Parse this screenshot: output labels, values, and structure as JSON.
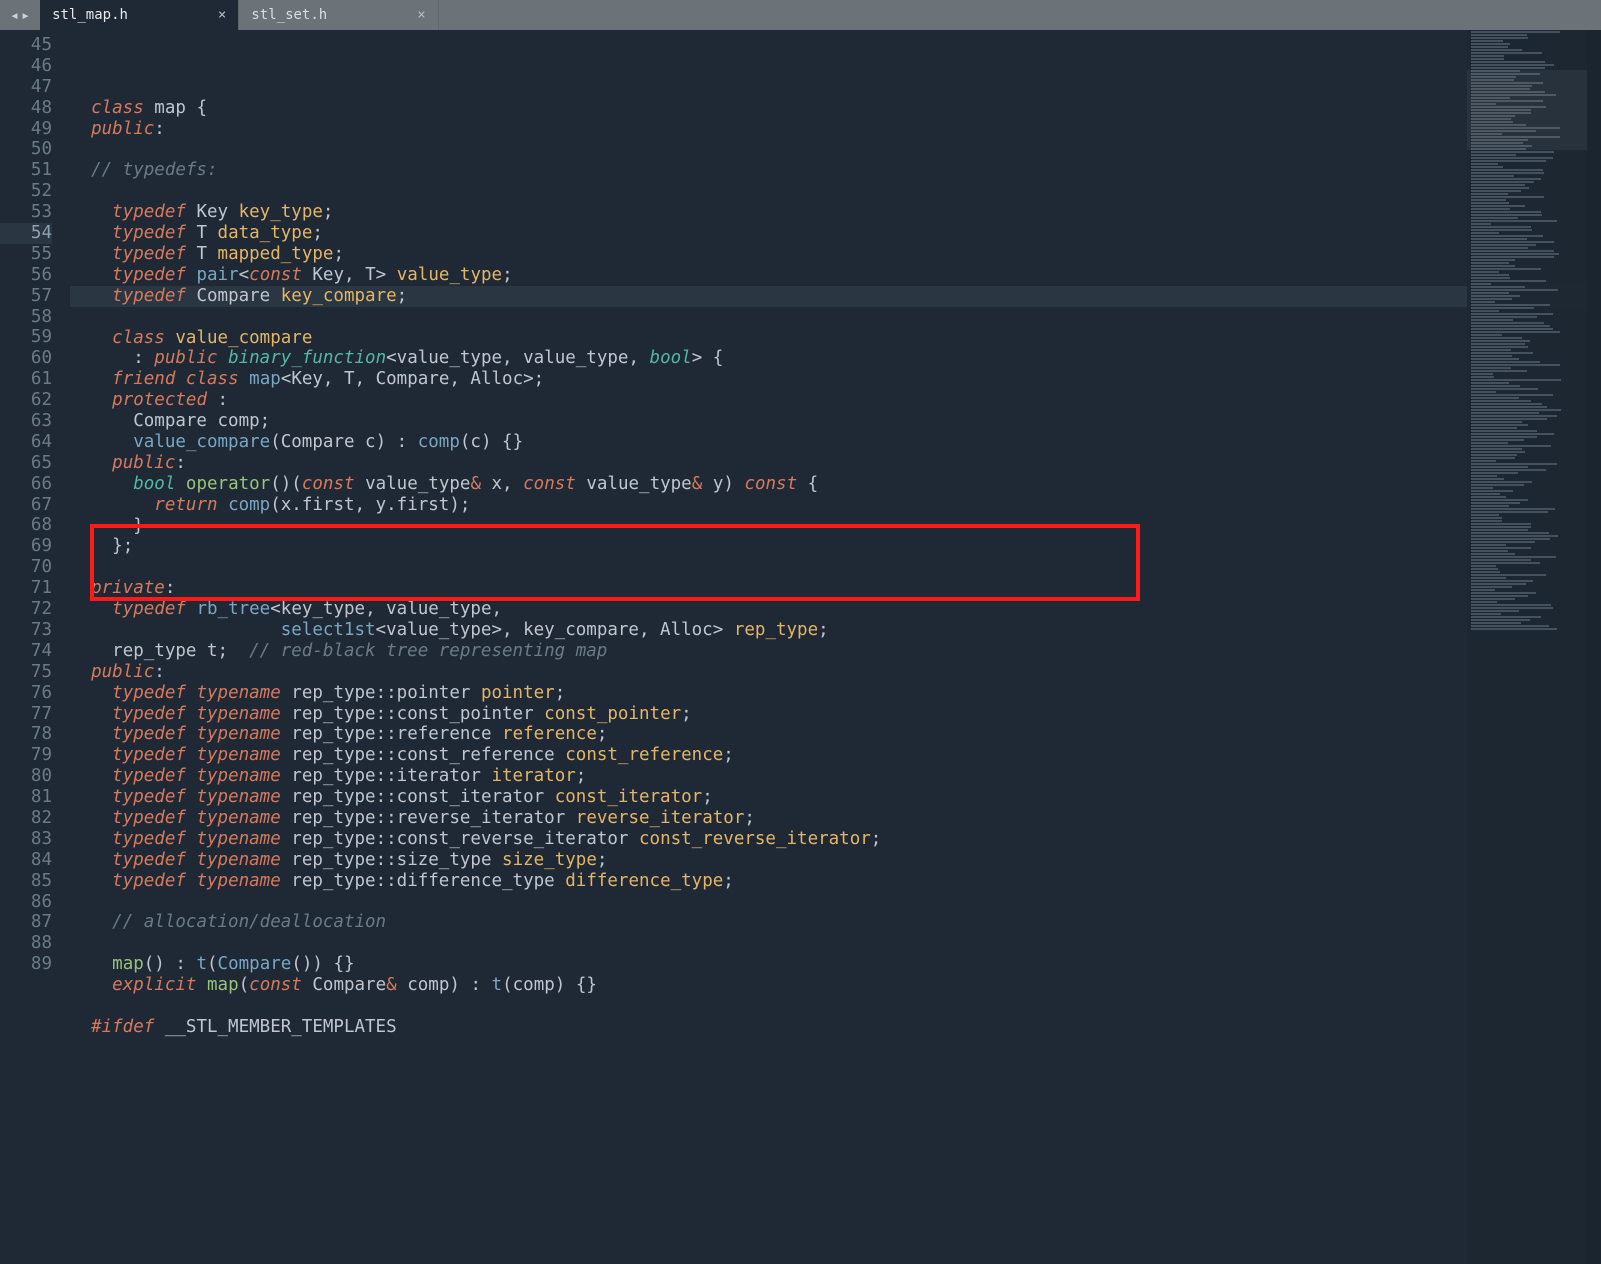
{
  "tabs": [
    {
      "label": "stl_map.h",
      "active": true
    },
    {
      "label": "stl_set.h",
      "active": false
    }
  ],
  "first_line_no": 45,
  "cursor_line_no": 54,
  "highlight_box": {
    "first_line_no": 68,
    "last_line_no": 71
  },
  "code_lines": [
    {
      "n": 45,
      "tokens": [
        [
          "  ",
          ""
        ],
        [
          "class",
          "kw"
        ],
        [
          " map ",
          " "
        ],
        [
          "{",
          "punc"
        ]
      ]
    },
    {
      "n": 46,
      "tokens": [
        [
          "  ",
          ""
        ],
        [
          "public",
          "kw"
        ],
        [
          ":",
          "punc"
        ]
      ]
    },
    {
      "n": 47,
      "tokens": [
        [
          "",
          ""
        ]
      ]
    },
    {
      "n": 48,
      "tokens": [
        [
          "  ",
          ""
        ],
        [
          "// typedefs:",
          "comment"
        ]
      ]
    },
    {
      "n": 49,
      "tokens": [
        [
          "",
          ""
        ]
      ]
    },
    {
      "n": 50,
      "tokens": [
        [
          "    ",
          ""
        ],
        [
          "typedef",
          "kw"
        ],
        [
          " Key ",
          " "
        ],
        [
          "key_type",
          "mem"
        ],
        [
          ";",
          "punc"
        ]
      ]
    },
    {
      "n": 51,
      "tokens": [
        [
          "    ",
          ""
        ],
        [
          "typedef",
          "kw"
        ],
        [
          " T ",
          " "
        ],
        [
          "data_type",
          "mem"
        ],
        [
          ";",
          "punc"
        ]
      ]
    },
    {
      "n": 52,
      "tokens": [
        [
          "    ",
          ""
        ],
        [
          "typedef",
          "kw"
        ],
        [
          " T ",
          " "
        ],
        [
          "mapped_type",
          "mem"
        ],
        [
          ";",
          "punc"
        ]
      ]
    },
    {
      "n": 53,
      "tokens": [
        [
          "    ",
          ""
        ],
        [
          "typedef",
          "kw"
        ],
        [
          " ",
          " "
        ],
        [
          "pair",
          "func"
        ],
        [
          "<",
          "punc"
        ],
        [
          "const",
          "kw"
        ],
        [
          " Key, T",
          " "
        ],
        [
          ">",
          "punc"
        ],
        [
          " ",
          " "
        ],
        [
          "value_type",
          "mem"
        ],
        [
          ";",
          "punc"
        ]
      ]
    },
    {
      "n": 54,
      "tokens": [
        [
          "    ",
          ""
        ],
        [
          "typedef",
          "kw"
        ],
        [
          " Compare ",
          " "
        ],
        [
          "key_compare",
          "mem"
        ],
        [
          ";",
          "punc"
        ]
      ]
    },
    {
      "n": 55,
      "tokens": [
        [
          "",
          ""
        ]
      ]
    },
    {
      "n": 56,
      "tokens": [
        [
          "    ",
          ""
        ],
        [
          "class",
          "kw"
        ],
        [
          " ",
          " "
        ],
        [
          "value_compare",
          "mem"
        ]
      ]
    },
    {
      "n": 57,
      "tokens": [
        [
          "      ",
          ""
        ],
        [
          ": ",
          "punc"
        ],
        [
          "public",
          "kw"
        ],
        [
          " ",
          " "
        ],
        [
          "binary_function",
          "teal"
        ],
        [
          "<",
          "punc"
        ],
        [
          "value_type, value_type, ",
          " "
        ],
        [
          "bool",
          "teal"
        ],
        [
          ">",
          "punc"
        ],
        [
          " {",
          "punc"
        ]
      ]
    },
    {
      "n": 58,
      "tokens": [
        [
          "    ",
          ""
        ],
        [
          "friend",
          "kw"
        ],
        [
          " ",
          " "
        ],
        [
          "class",
          "kw"
        ],
        [
          " ",
          " "
        ],
        [
          "map",
          "func"
        ],
        [
          "<",
          "punc"
        ],
        [
          "Key, T, Compare, Alloc",
          " "
        ],
        [
          ">",
          "punc"
        ],
        [
          ";",
          "punc"
        ]
      ]
    },
    {
      "n": 59,
      "tokens": [
        [
          "    ",
          ""
        ],
        [
          "protected",
          "kw"
        ],
        [
          " :",
          "punc"
        ]
      ]
    },
    {
      "n": 60,
      "tokens": [
        [
          "      ",
          ""
        ],
        [
          "Compare comp;",
          "type"
        ]
      ]
    },
    {
      "n": 61,
      "tokens": [
        [
          "      ",
          ""
        ],
        [
          "value_compare",
          "func"
        ],
        [
          "(",
          "punc"
        ],
        [
          "Compare c",
          " "
        ],
        [
          ")",
          "punc"
        ],
        [
          " : ",
          "punc"
        ],
        [
          "comp",
          "func"
        ],
        [
          "(",
          "punc"
        ],
        [
          "c",
          " "
        ],
        [
          ")",
          "punc"
        ],
        [
          " {}",
          "punc"
        ]
      ]
    },
    {
      "n": 62,
      "tokens": [
        [
          "    ",
          ""
        ],
        [
          "public",
          "kw"
        ],
        [
          ":",
          "punc"
        ]
      ]
    },
    {
      "n": 63,
      "tokens": [
        [
          "      ",
          ""
        ],
        [
          "bool",
          "teal"
        ],
        [
          " ",
          " "
        ],
        [
          "operator",
          "green"
        ],
        [
          "()",
          "punc"
        ],
        [
          "(",
          "punc"
        ],
        [
          "const",
          "kw"
        ],
        [
          " value_type",
          " "
        ],
        [
          "&",
          "amp"
        ],
        [
          " x, ",
          " "
        ],
        [
          "const",
          "kw"
        ],
        [
          " value_type",
          " "
        ],
        [
          "&",
          "amp"
        ],
        [
          " y",
          " "
        ],
        [
          ")",
          "punc"
        ],
        [
          " ",
          " "
        ],
        [
          "const",
          "kw"
        ],
        [
          " {",
          "punc"
        ]
      ]
    },
    {
      "n": 64,
      "tokens": [
        [
          "        ",
          ""
        ],
        [
          "return",
          "kw"
        ],
        [
          " ",
          " "
        ],
        [
          "comp",
          "func"
        ],
        [
          "(",
          "punc"
        ],
        [
          "x.first, y.first",
          " "
        ],
        [
          ")",
          "punc"
        ],
        [
          ";",
          "punc"
        ]
      ]
    },
    {
      "n": 65,
      "tokens": [
        [
          "      ",
          ""
        ],
        [
          "}",
          "punc"
        ]
      ]
    },
    {
      "n": 66,
      "tokens": [
        [
          "    ",
          ""
        ],
        [
          "};",
          "punc"
        ]
      ]
    },
    {
      "n": 67,
      "tokens": [
        [
          "",
          ""
        ]
      ]
    },
    {
      "n": 68,
      "tokens": [
        [
          "  ",
          ""
        ],
        [
          "private",
          "kw"
        ],
        [
          ":",
          "punc"
        ]
      ]
    },
    {
      "n": 69,
      "tokens": [
        [
          "    ",
          ""
        ],
        [
          "typedef",
          "kw"
        ],
        [
          " ",
          " "
        ],
        [
          "rb_tree",
          "func"
        ],
        [
          "<",
          "punc"
        ],
        [
          "key_type, value_type, ",
          " "
        ]
      ]
    },
    {
      "n": 70,
      "tokens": [
        [
          "                    ",
          ""
        ],
        [
          "select1st",
          "func"
        ],
        [
          "<",
          "punc"
        ],
        [
          "value_type",
          " "
        ],
        [
          ">",
          "punc"
        ],
        [
          ", key_compare, Alloc",
          " "
        ],
        [
          ">",
          "punc"
        ],
        [
          " ",
          " "
        ],
        [
          "rep_type",
          "mem"
        ],
        [
          ";",
          "punc"
        ]
      ]
    },
    {
      "n": 71,
      "tokens": [
        [
          "    ",
          ""
        ],
        [
          "rep_type t;  ",
          " "
        ],
        [
          "// red-black tree representing map",
          "comment"
        ]
      ]
    },
    {
      "n": 72,
      "tokens": [
        [
          "  ",
          ""
        ],
        [
          "public",
          "kw"
        ],
        [
          ":",
          "punc"
        ]
      ]
    },
    {
      "n": 73,
      "tokens": [
        [
          "    ",
          ""
        ],
        [
          "typedef",
          "kw"
        ],
        [
          " ",
          " "
        ],
        [
          "typename",
          "kw"
        ],
        [
          " rep_type::pointer ",
          " "
        ],
        [
          "pointer",
          "mem"
        ],
        [
          ";",
          "punc"
        ]
      ]
    },
    {
      "n": 74,
      "tokens": [
        [
          "    ",
          ""
        ],
        [
          "typedef",
          "kw"
        ],
        [
          " ",
          " "
        ],
        [
          "typename",
          "kw"
        ],
        [
          " rep_type::const_pointer ",
          " "
        ],
        [
          "const_pointer",
          "mem"
        ],
        [
          ";",
          "punc"
        ]
      ]
    },
    {
      "n": 75,
      "tokens": [
        [
          "    ",
          ""
        ],
        [
          "typedef",
          "kw"
        ],
        [
          " ",
          " "
        ],
        [
          "typename",
          "kw"
        ],
        [
          " rep_type::reference ",
          " "
        ],
        [
          "reference",
          "mem"
        ],
        [
          ";",
          "punc"
        ]
      ]
    },
    {
      "n": 76,
      "tokens": [
        [
          "    ",
          ""
        ],
        [
          "typedef",
          "kw"
        ],
        [
          " ",
          " "
        ],
        [
          "typename",
          "kw"
        ],
        [
          " rep_type::const_reference ",
          " "
        ],
        [
          "const_reference",
          "mem"
        ],
        [
          ";",
          "punc"
        ]
      ]
    },
    {
      "n": 77,
      "tokens": [
        [
          "    ",
          ""
        ],
        [
          "typedef",
          "kw"
        ],
        [
          " ",
          " "
        ],
        [
          "typename",
          "kw"
        ],
        [
          " rep_type::iterator ",
          " "
        ],
        [
          "iterator",
          "mem"
        ],
        [
          ";",
          "punc"
        ]
      ]
    },
    {
      "n": 78,
      "tokens": [
        [
          "    ",
          ""
        ],
        [
          "typedef",
          "kw"
        ],
        [
          " ",
          " "
        ],
        [
          "typename",
          "kw"
        ],
        [
          " rep_type::const_iterator ",
          " "
        ],
        [
          "const_iterator",
          "mem"
        ],
        [
          ";",
          "punc"
        ]
      ]
    },
    {
      "n": 79,
      "tokens": [
        [
          "    ",
          ""
        ],
        [
          "typedef",
          "kw"
        ],
        [
          " ",
          " "
        ],
        [
          "typename",
          "kw"
        ],
        [
          " rep_type::reverse_iterator ",
          " "
        ],
        [
          "reverse_iterator",
          "mem"
        ],
        [
          ";",
          "punc"
        ]
      ]
    },
    {
      "n": 80,
      "tokens": [
        [
          "    ",
          ""
        ],
        [
          "typedef",
          "kw"
        ],
        [
          " ",
          " "
        ],
        [
          "typename",
          "kw"
        ],
        [
          " rep_type::const_reverse_iterator ",
          " "
        ],
        [
          "const_reverse_iterator",
          "mem"
        ],
        [
          ";",
          "punc"
        ]
      ]
    },
    {
      "n": 81,
      "tokens": [
        [
          "    ",
          ""
        ],
        [
          "typedef",
          "kw"
        ],
        [
          " ",
          " "
        ],
        [
          "typename",
          "kw"
        ],
        [
          " rep_type::size_type ",
          " "
        ],
        [
          "size_type",
          "mem"
        ],
        [
          ";",
          "punc"
        ]
      ]
    },
    {
      "n": 82,
      "tokens": [
        [
          "    ",
          ""
        ],
        [
          "typedef",
          "kw"
        ],
        [
          " ",
          " "
        ],
        [
          "typename",
          "kw"
        ],
        [
          " rep_type::difference_type ",
          " "
        ],
        [
          "difference_type",
          "mem"
        ],
        [
          ";",
          "punc"
        ]
      ]
    },
    {
      "n": 83,
      "tokens": [
        [
          "",
          ""
        ]
      ]
    },
    {
      "n": 84,
      "tokens": [
        [
          "    ",
          ""
        ],
        [
          "// allocation/deallocation",
          "comment"
        ]
      ]
    },
    {
      "n": 85,
      "tokens": [
        [
          "",
          ""
        ]
      ]
    },
    {
      "n": 86,
      "tokens": [
        [
          "    ",
          ""
        ],
        [
          "map",
          "green"
        ],
        [
          "()",
          "punc"
        ],
        [
          " : ",
          "punc"
        ],
        [
          "t",
          "func"
        ],
        [
          "(",
          "punc"
        ],
        [
          "Compare",
          "func"
        ],
        [
          "()",
          "punc"
        ],
        [
          ")",
          "punc"
        ],
        [
          " {}",
          "punc"
        ]
      ]
    },
    {
      "n": 87,
      "tokens": [
        [
          "    ",
          ""
        ],
        [
          "explicit",
          "kw"
        ],
        [
          " ",
          " "
        ],
        [
          "map",
          "green"
        ],
        [
          "(",
          "punc"
        ],
        [
          "const",
          "kw"
        ],
        [
          " Compare",
          " "
        ],
        [
          "&",
          "amp"
        ],
        [
          " comp",
          " "
        ],
        [
          ")",
          "punc"
        ],
        [
          " : ",
          "punc"
        ],
        [
          "t",
          "func"
        ],
        [
          "(",
          "punc"
        ],
        [
          "comp",
          " "
        ],
        [
          ")",
          "punc"
        ],
        [
          " {}",
          "punc"
        ]
      ]
    },
    {
      "n": 88,
      "tokens": [
        [
          "",
          ""
        ]
      ]
    },
    {
      "n": 89,
      "tokens": [
        [
          "  ",
          ""
        ],
        [
          "#ifdef",
          "kw"
        ],
        [
          " __STL_MEMBER_TEMPLATES",
          " "
        ]
      ]
    }
  ]
}
